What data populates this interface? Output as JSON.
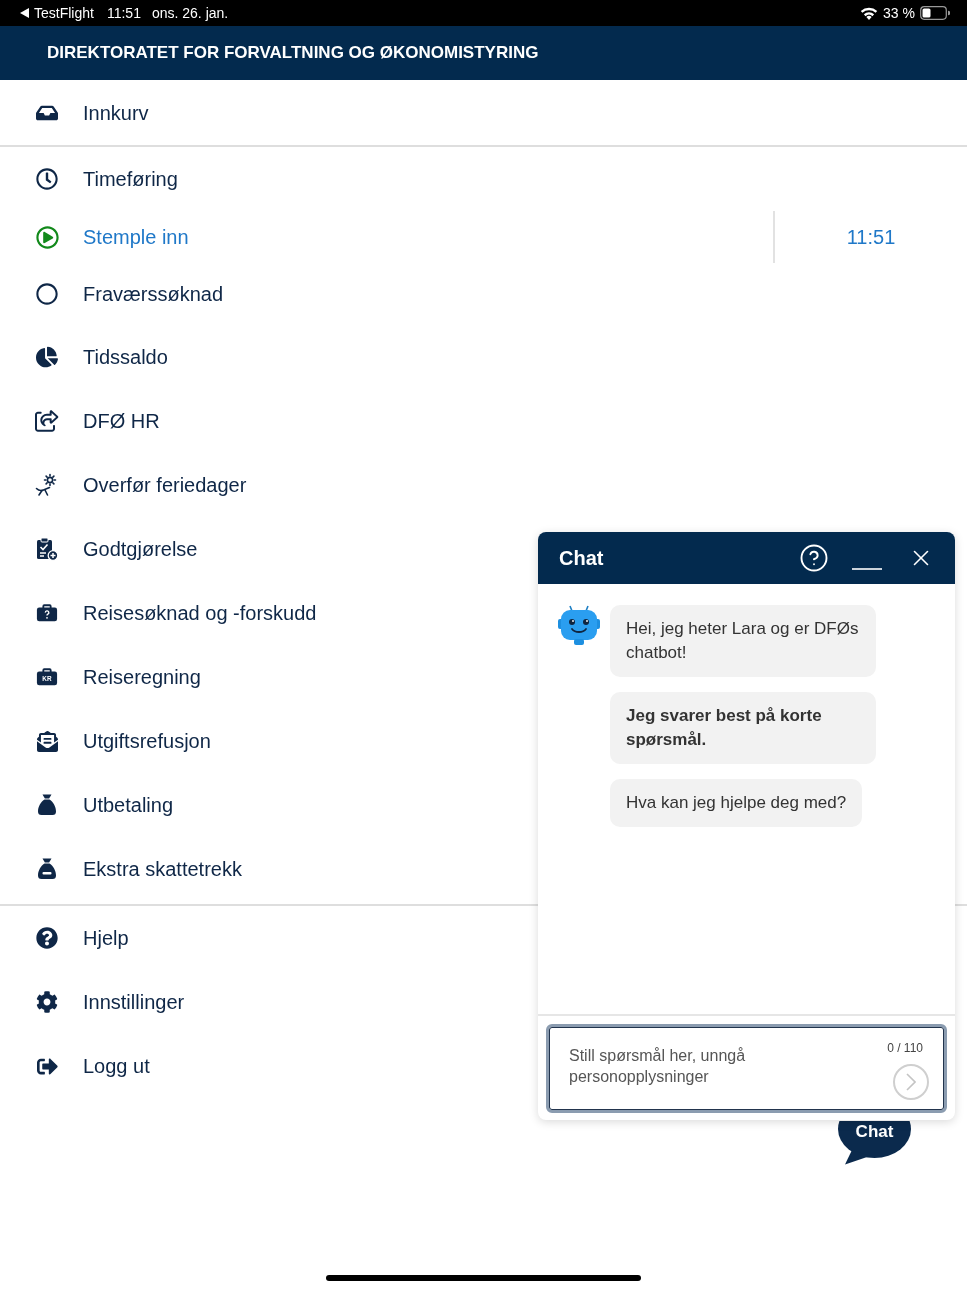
{
  "status_bar": {
    "back_label": "TestFlight",
    "time": "11:51",
    "date": "ons. 26. jan.",
    "battery": "33 %"
  },
  "header": {
    "title": "DIREKTORATET FOR FORVALTNING OG ØKONOMISTYRING"
  },
  "menu": {
    "sections": [
      {
        "items": [
          {
            "label": "Innkurv",
            "selected": false
          }
        ]
      },
      {
        "items": [
          {
            "label": "Timeføring",
            "selected": false
          },
          {
            "label": "Stemple inn",
            "selected": true,
            "time": "11:51"
          },
          {
            "label": "Fraværssøknad",
            "selected": false
          },
          {
            "label": "Tidssaldo",
            "selected": false
          },
          {
            "label": "DFØ HR",
            "selected": false
          },
          {
            "label": "Overfør feriedager",
            "selected": false
          },
          {
            "label": "Godtgjørelse",
            "selected": false
          },
          {
            "label": "Reisesøknad og -forskudd",
            "selected": false
          },
          {
            "label": "Reiseregning",
            "selected": false,
            "icon_text": "KR"
          },
          {
            "label": "Utgiftsrefusjon",
            "selected": false
          },
          {
            "label": "Utbetaling",
            "selected": false
          },
          {
            "label": "Ekstra skattetrekk",
            "selected": false
          }
        ]
      },
      {
        "items": [
          {
            "label": "Hjelp",
            "selected": false
          },
          {
            "label": "Innstillinger",
            "selected": false
          },
          {
            "label": "Logg ut",
            "selected": false
          }
        ]
      }
    ]
  },
  "chat": {
    "title": "Chat",
    "messages": [
      {
        "text": "Hei, jeg heter Lara og er DFØs chatbot!",
        "bold": false
      },
      {
        "text": "Jeg svarer best på korte spørsmål.",
        "bold": true
      },
      {
        "text": "Hva kan jeg hjelpe deg med?",
        "bold": false
      }
    ],
    "input": {
      "placeholder": "Still spørsmål her, unngå personopplysninger",
      "counter": "0 / 110"
    }
  },
  "chat_launcher": {
    "label": "Chat"
  }
}
